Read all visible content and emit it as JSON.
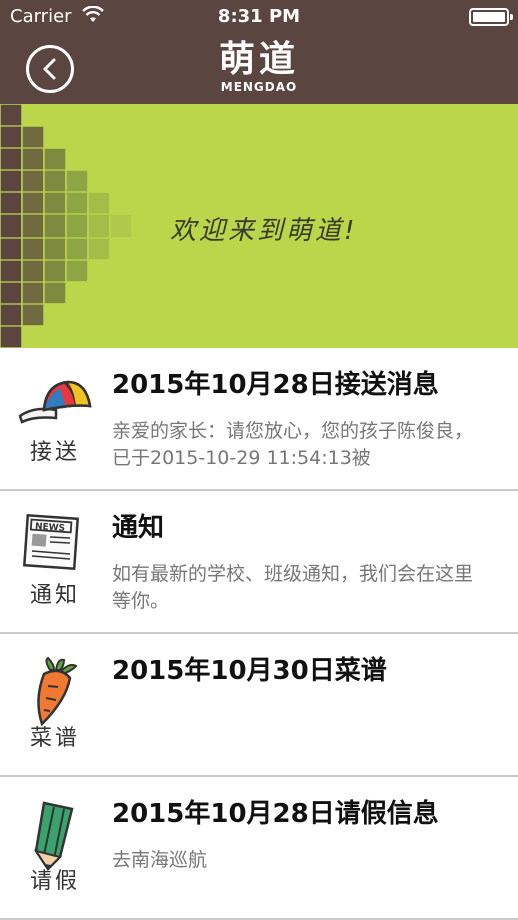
{
  "status_bar": {
    "carrier": "Carrier",
    "time": "8:31 PM"
  },
  "nav": {
    "title": "萌道",
    "subtitle": "MENGDAO",
    "back_icon": "chevron-left-icon"
  },
  "banner": {
    "welcome": "欢迎来到萌道!",
    "bg_color": "#bcd64c"
  },
  "items": [
    {
      "icon": "cap-icon",
      "label": "接送",
      "title": "2015年10月28日接送消息",
      "body": "亲爱的家长：请您放心，您的孩子陈俊良，已于2015-10-29 11:54:13被"
    },
    {
      "icon": "newspaper-icon",
      "label": "通知",
      "title": "通知",
      "body": "如有最新的学校、班级通知，我们会在这里等你。"
    },
    {
      "icon": "carrot-icon",
      "label": "菜谱",
      "title": "2015年10月30日菜谱",
      "body": ""
    },
    {
      "icon": "pencil-icon",
      "label": "请假",
      "title": "2015年10月28日请假信息",
      "body": "去南海巡航"
    }
  ]
}
